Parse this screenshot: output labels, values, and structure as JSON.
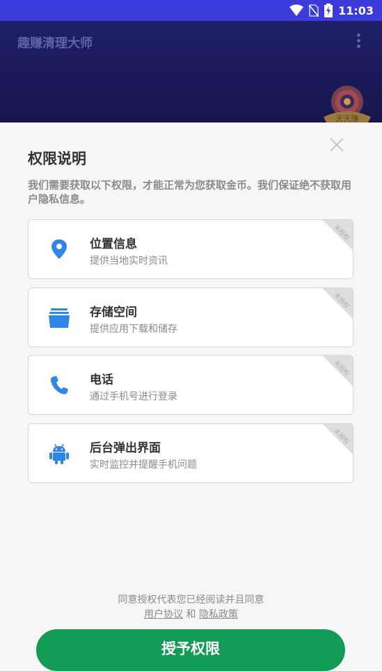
{
  "status_bar": {
    "time": "11:03",
    "bg_color": "#3b3bdb"
  },
  "app_bar": {
    "title": "趣赚清理大师",
    "bg_color": "#1c1c5e",
    "wheel_label": "天天赚"
  },
  "sheet": {
    "title": "权限说明",
    "description": "我们需要获取以下权限，才能正常为您获取金币。我们保证绝不获取用户隐私信息。",
    "permissions": [
      {
        "icon": "location-pin-icon",
        "title": "位置信息",
        "subtitle": "提供当地实时资讯",
        "badge": "未授权"
      },
      {
        "icon": "storage-icon",
        "title": "存储空间",
        "subtitle": "提供应用下载和储存",
        "badge": "未授权"
      },
      {
        "icon": "phone-icon",
        "title": "电话",
        "subtitle": "通过手机号进行登录",
        "badge": "未授权"
      },
      {
        "icon": "android-icon",
        "title": "后台弹出界面",
        "subtitle": "实时监控并提醒手机问题",
        "badge": "未授权"
      }
    ],
    "agreement": {
      "text": "同意授权代表您已经阅读并且同意",
      "user_agreement": "用户协议",
      "and": "和",
      "privacy_policy": "隐私政策"
    },
    "grant_button": "授予权限",
    "accent_color": "#139a55",
    "icon_color": "#2f86e6"
  }
}
